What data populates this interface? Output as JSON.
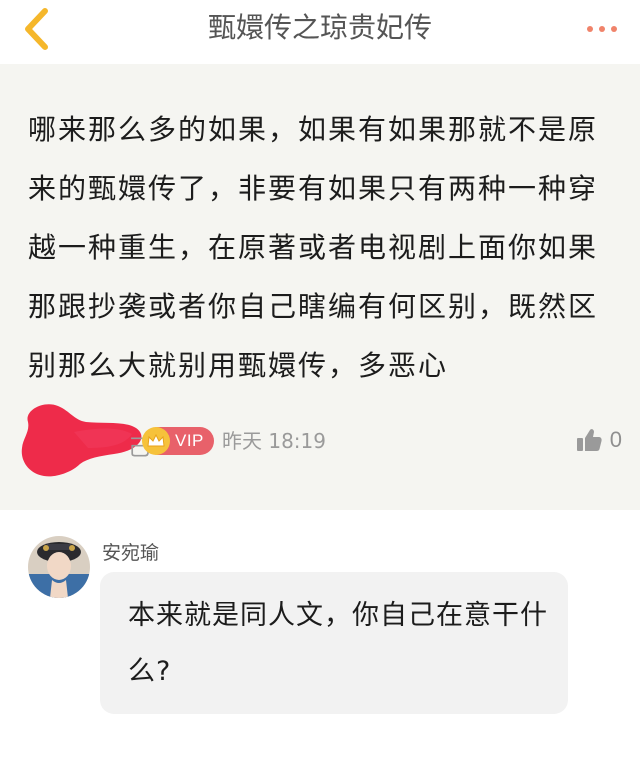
{
  "navbar": {
    "back_icon": "chevron-left-icon",
    "title": "甄嬛传之琼贵妃传",
    "more_icon": "more-dots-icon",
    "accent_color": "#f5b72b",
    "more_color": "#f0836a"
  },
  "post": {
    "text": "哪来那么多的如果，如果有如果那就不是原来的甄嬛传了，非要有如果只有两种一种穿越一种重生，在原著或者电视剧上面你如果那跟抄袭或者你自己瞎编有何区别，既然区别那么大就别用甄嬛传，多恶心",
    "author_name_visible": "己",
    "vip_label": "VIP",
    "vip_icon": "crown-icon",
    "time": "昨天 18:19",
    "like_icon": "thumbs-up-icon",
    "like_count": "0",
    "redaction_color": "#ee2b4a"
  },
  "reply": {
    "author_name": "安宛瑜",
    "text": "本来就是同人文，你自己在意干什么?"
  }
}
